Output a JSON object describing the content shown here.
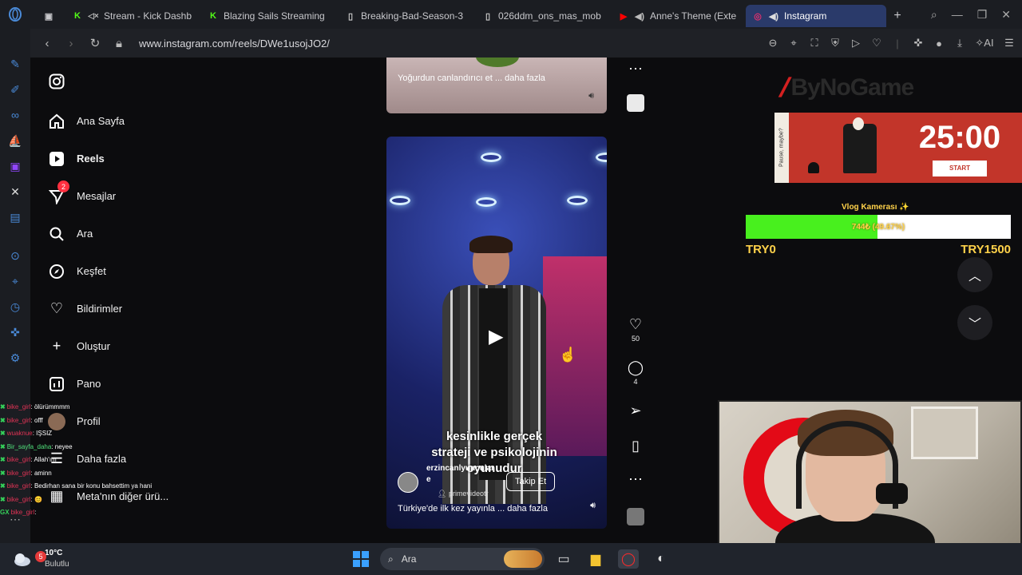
{
  "tabs": [
    {
      "title": "Stream - Kick Dashb",
      "icon": "kick-icon",
      "color": "#53fc18"
    },
    {
      "title": "Blazing Sails Streaming",
      "icon": "kick-icon",
      "color": "#53fc18"
    },
    {
      "title": "Breaking-Bad-Season-3",
      "icon": "document-icon",
      "color": "#cfcfcf"
    },
    {
      "title": "026ddm_ons_mas_mob",
      "icon": "document-icon",
      "color": "#cfcfcf"
    },
    {
      "title": "Anne's Theme (Exte",
      "icon": "youtube-icon",
      "color": "#ff0000"
    },
    {
      "title": "Instagram",
      "icon": "instagram-icon",
      "color": "#e1306c"
    }
  ],
  "address": {
    "url": "www.instagram.com/reels/DWe1usojJO2/"
  },
  "ig_nav": {
    "items": [
      {
        "label": "Ana Sayfa",
        "icon": "home-icon"
      },
      {
        "label": "Reels",
        "icon": "reels-icon"
      },
      {
        "label": "Mesajlar",
        "icon": "messenger-icon",
        "badge": "2"
      },
      {
        "label": "Ara",
        "icon": "search-icon"
      },
      {
        "label": "Keşfet",
        "icon": "compass-icon"
      },
      {
        "label": "Bildirimler",
        "icon": "heart-icon"
      },
      {
        "label": "Oluştur",
        "icon": "plus-icon"
      },
      {
        "label": "Pano",
        "icon": "chart-icon"
      },
      {
        "label": "Profil",
        "icon": "avatar-icon"
      },
      {
        "label": "Daha fazla",
        "icon": "menu-icon"
      },
      {
        "label": "Meta'nın diğer ürü...",
        "icon": "meta-icon"
      }
    ]
  },
  "reel_top": {
    "caption": "Yoğurdun canlandırıcı et ... daha fazla"
  },
  "reel_main": {
    "overlay_text": "kesinlikle gerçek strateji ve psikolojinin oyunudur",
    "author": "erzincanlyuncular",
    "author_suffix": "e",
    "sub_account": "primevideotr",
    "follow_label": "Takip Et",
    "caption": "Türkiye'de ilk kez yayınla ... daha fazla"
  },
  "actions": {
    "likes": "50",
    "comments": "4"
  },
  "chat": [
    {
      "user": "bike_girl",
      "msg": ": ölürümmmm",
      "color": "u"
    },
    {
      "user": "bike_girl",
      "msg": ": offf",
      "color": "u"
    },
    {
      "user": "wuaknue",
      "msg": ": IŞSIZ",
      "color": "u"
    },
    {
      "user": "Bir_sayfa_daha",
      "msg": ": neyee",
      "color": "u3"
    },
    {
      "user": "bike_girl",
      "msg": ": Allah'ım",
      "color": "u"
    },
    {
      "user": "bike_girl",
      "msg": ": aminn",
      "color": "u"
    },
    {
      "user": "bike_girl",
      "msg": ": Bedirhan sana bir konu bahsettim ya hani",
      "color": "u"
    },
    {
      "user": "bike_girl",
      "msg": ": 😊",
      "color": "u"
    },
    {
      "user": "bike_girl",
      "msg": ":",
      "color": "u"
    }
  ],
  "widgets": {
    "brand": "ByNoGame",
    "pomodoro_side": "Pause, maybe?",
    "timer": "25:00",
    "start_label": "START",
    "goal_title": "Vlog Kamerası ✨",
    "goal_text": "744₺ (49.67%)",
    "goal_progress": 0.4967,
    "goal_min": "TRY0",
    "goal_max": "TRY1500"
  },
  "taskbar": {
    "temp": "10°C",
    "weather": "Bulutlu",
    "weather_badge": "5",
    "search_label": "Ara"
  },
  "colors": {
    "accent": "#2a3a6a",
    "goal_fill": "#48f01e",
    "goal_text": "#ffd24a",
    "pomodoro": "#c2352a"
  }
}
